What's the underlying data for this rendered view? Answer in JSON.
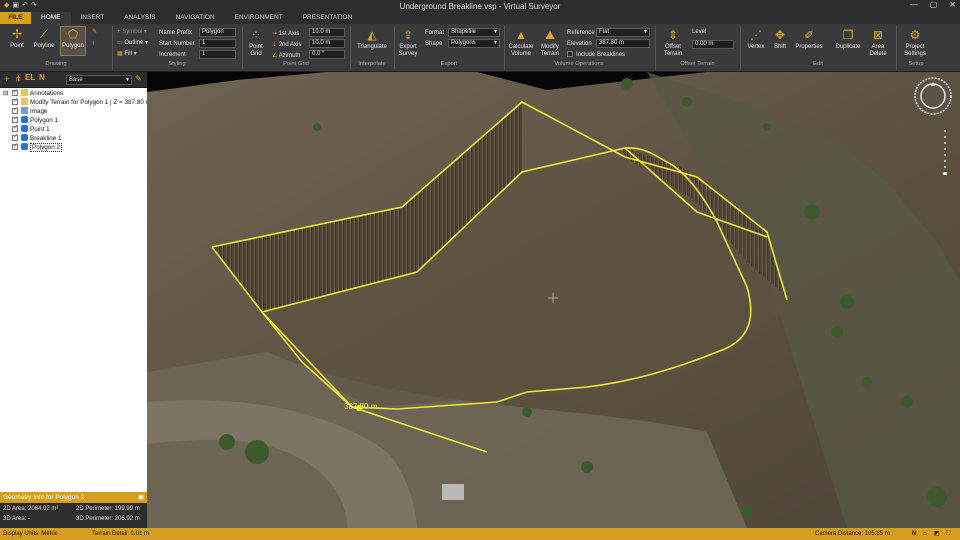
{
  "window": {
    "title": "Underground Breakline.vsp  -  Virtual Surveyor",
    "minimize": "—",
    "maximize": "▢",
    "close": "✕"
  },
  "tabs": [
    {
      "label": "FILE"
    },
    {
      "label": "HOME"
    },
    {
      "label": "INSERT"
    },
    {
      "label": "ANALYSIS"
    },
    {
      "label": "NAVIGATION"
    },
    {
      "label": "ENVIRONMENT"
    },
    {
      "label": "PRESENTATION"
    }
  ],
  "ribbon": {
    "drawing": {
      "label": "Drawing",
      "point": "Point",
      "polyline": "Polyline",
      "polygon": "Polygon"
    },
    "styling": {
      "label": "Styling",
      "symbol": "Symbol",
      "outline": "Outline",
      "fill": "Fill"
    },
    "naming": {
      "name_prefix_label": "Name Prefix",
      "name_prefix": "Polygon",
      "start_number_label": "Start Number",
      "start_number": "1",
      "increment_label": "Increment",
      "increment": "1"
    },
    "point_grid": {
      "label": "Point Grid",
      "button": "Point Grid",
      "axis1_label": "1st Axis",
      "axis1": "10.0 m",
      "axis2_label": "2nd Axis",
      "axis2": "10.0 m",
      "azimuth_label": "Azimuth",
      "azimuth": "0.0 °"
    },
    "interpolate": {
      "label": "Interpolate",
      "triangulate": "Triangulate"
    },
    "export": {
      "label": "Export",
      "export_survey": "Export Survey",
      "format_label": "Format",
      "format": "Shapefile",
      "shape_label": "Shape",
      "shape": "Polygons"
    },
    "volume": {
      "label": "Volume Operations",
      "calculate": "Calculate Volume",
      "modify": "Modify Terrain",
      "reference_label": "Reference",
      "reference": "Flat",
      "elevation_label": "Elevation",
      "elevation": "387.80 m",
      "include_breaklines": "Include Breaklines"
    },
    "offset": {
      "label": "Offset Terrain",
      "button": "Offset Terrain",
      "level_label": "Level",
      "level": "0.00 m"
    },
    "edit": {
      "label": "Edit",
      "vertex": "Vertex",
      "shift": "Shift",
      "properties": "Properties",
      "duplicate": "Duplicate",
      "area_delete": "Area Delete"
    },
    "setup": {
      "label": "Setup",
      "project_settings": "Project Settings"
    }
  },
  "leftpanel": {
    "layer_select": "Base",
    "el_label": "EL",
    "n_label": "N",
    "items": [
      {
        "label": "Annotations"
      },
      {
        "label": "Modify Terrain for Polygon 1 | Z = 387.80 m"
      },
      {
        "label": "Image"
      },
      {
        "label": "Polygon 1"
      },
      {
        "label": "Point 1"
      },
      {
        "label": "Breakline 1"
      },
      {
        "label": "Polygon 2"
      }
    ],
    "geometry": {
      "title": "Geometry Info for Polygon 2",
      "area2d": "2D Area: 2064.02 m²",
      "area3d": "3D Area: -",
      "perim2d": "2D Perimeter: 199.99 m",
      "perim3d": "3D Perimeter: 206.92 m"
    }
  },
  "viewport": {
    "elevation_label": "387.80 m",
    "compass_letter": "N"
  },
  "status": {
    "units": "Display Units: Metric",
    "terrain": "Terrain Detail: 0.01 m",
    "camera": "Camera Distance: 105.85 m"
  },
  "colors": {
    "accent": "#d59e1f",
    "line": "#f0e63a"
  }
}
